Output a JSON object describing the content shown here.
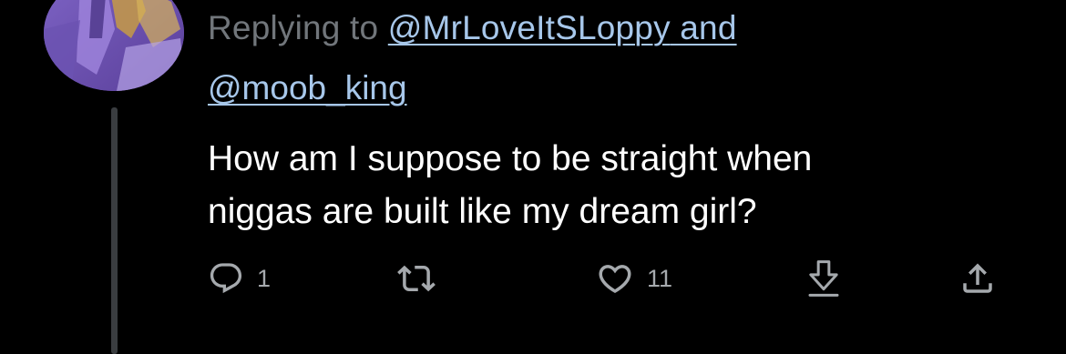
{
  "reply_header": {
    "prefix": "Replying to ",
    "mention_1": "@MrLoveItSLoppy",
    "connector": " and",
    "mention_2": "@moob_king"
  },
  "tweet": {
    "text": "How am I suppose to be straight when\nniggas are built like my dream girl?"
  },
  "actions": {
    "reply": {
      "icon": "speech-bubble-icon",
      "count": "1"
    },
    "retweet": {
      "icon": "retweet-icon",
      "count": ""
    },
    "like": {
      "icon": "heart-icon",
      "count": "11"
    },
    "download": {
      "icon": "download-arrow-icon"
    },
    "share": {
      "icon": "share-icon"
    }
  },
  "colors": {
    "background": "#000000",
    "text": "#ffffff",
    "muted": "#71767b",
    "link": "#a7c7ea",
    "thread_line": "#3a3d40",
    "icon": "#a5a9ad"
  }
}
